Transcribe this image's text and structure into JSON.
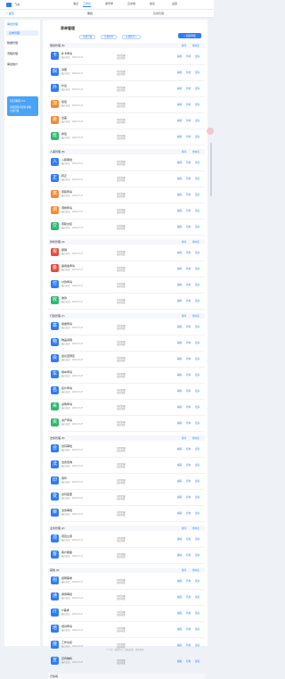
{
  "header": {
    "brand": "飞书",
    "nav": [
      "消息",
      "工作台",
      "通讯录",
      "云文档",
      "会议",
      "设置"
    ],
    "active": 1
  },
  "sub": {
    "back": "< 返回",
    "title": "审批",
    "page": "应用管理"
  },
  "sidebar": {
    "head": "审批管理",
    "items": [
      "表单管理",
      "数据管理",
      "流程管理",
      "审批统计"
    ],
    "active": 0,
    "promo": {
      "title": "钉钉审批 2.0",
      "body": "审批流程可视化 模板全新升级"
    }
  },
  "main": {
    "title": "表单管理",
    "btn_add": "新建分组",
    "btn_sort": "分组排序",
    "btn_import": "从模板导入",
    "btn_primary": "+ 创建审批"
  },
  "actions": {
    "edit": "编辑",
    "stop": "停用",
    "more": "更多",
    "sort": "排序",
    "rename": "重命名"
  },
  "groups": [
    {
      "name": "假勤管理",
      "count": "6",
      "items": [
        {
          "name": "补卡申请",
          "icon": "卡",
          "color": "#2f7cf6",
          "meta": "最近修改：2023-07-27",
          "range": "可见范围",
          "scope": "全员可见"
        },
        {
          "name": "请假",
          "icon": "假",
          "color": "#2f7cf6",
          "meta": "最近修改：2023-07-27",
          "range": "可见范围",
          "scope": "全员可见"
        },
        {
          "name": "外出",
          "icon": "外",
          "color": "#2f7cf6",
          "meta": "最近修改：2023-07-27",
          "range": "可见范围",
          "scope": "全员可见"
        },
        {
          "name": "加班",
          "icon": "加",
          "color": "#f58a32",
          "meta": "最近修改：2023-07-27",
          "range": "可见范围",
          "scope": "全员可见"
        },
        {
          "name": "出差",
          "icon": "差",
          "color": "#f58a32",
          "meta": "最近修改：2023-07-27",
          "range": "可见范围",
          "scope": "全员可见"
        },
        {
          "name": "换班",
          "icon": "班",
          "color": "#2eb872",
          "meta": "最近修改：2023-07-27",
          "range": "可见范围",
          "scope": "全员可见"
        }
      ]
    },
    {
      "name": "人事管理",
      "count": "5",
      "items": [
        {
          "name": "入职审批",
          "icon": "入",
          "color": "#2f7cf6",
          "meta": "最近修改：2023-07-27",
          "range": "可见范围",
          "scope": "全员可见"
        },
        {
          "name": "转正",
          "icon": "正",
          "color": "#2f7cf6",
          "meta": "最近修改：2023-07-27",
          "range": "可见范围",
          "scope": "全员可见"
        },
        {
          "name": "离职申请",
          "icon": "离",
          "color": "#f58a32",
          "meta": "最近修改：2023-07-27",
          "range": "可见范围",
          "scope": "全员可见"
        },
        {
          "name": "调岗申请",
          "icon": "调",
          "color": "#f58a32",
          "meta": "最近修改：2023-07-27",
          "range": "可见范围",
          "scope": "全员可见"
        },
        {
          "name": "离职交接",
          "icon": "交",
          "color": "#2eb872",
          "meta": "最近修改：2023-07-27",
          "range": "可见范围",
          "scope": "全员可见"
        }
      ]
    },
    {
      "name": "财务管理",
      "count": "4",
      "items": [
        {
          "name": "报销",
          "icon": "报",
          "color": "#e74c3c",
          "meta": "最近修改：2023-07-27",
          "range": "可见范围",
          "scope": "全员可见"
        },
        {
          "name": "备用金申请",
          "icon": "备",
          "color": "#e74c3c",
          "meta": "最近修改：2023-07-27",
          "range": "可见范围",
          "scope": "全员可见"
        },
        {
          "name": "付款申请",
          "icon": "付",
          "color": "#2f7cf6",
          "meta": "最近修改：2023-07-27",
          "range": "可见范围",
          "scope": "全员可见"
        },
        {
          "name": "收款",
          "icon": "收",
          "color": "#2eb872",
          "meta": "最近修改：2023-07-27",
          "range": "可见范围",
          "scope": "全员可见"
        }
      ]
    },
    {
      "name": "行政管理",
      "count": "7",
      "items": [
        {
          "name": "用章申请",
          "icon": "章",
          "color": "#2f7cf6",
          "meta": "最近修改：2023-07-27",
          "range": "可见范围",
          "scope": "全员可见"
        },
        {
          "name": "物品领用",
          "icon": "物",
          "color": "#2f7cf6",
          "meta": "最近修改：2023-07-27",
          "range": "可见范围",
          "scope": "全员可见"
        },
        {
          "name": "会议室预定",
          "icon": "会",
          "color": "#2f7cf6",
          "meta": "最近修改：2023-07-27",
          "range": "可见范围",
          "scope": "全员可见"
        },
        {
          "name": "用车申请",
          "icon": "车",
          "color": "#2f7cf6",
          "meta": "最近修改：2023-07-27",
          "range": "可见范围",
          "scope": "全员可见"
        },
        {
          "name": "名片申请",
          "icon": "名",
          "color": "#2f7cf6",
          "meta": "最近修改：2023-07-27",
          "range": "可见范围",
          "scope": "全员可见"
        },
        {
          "name": "采购申请",
          "icon": "采",
          "color": "#2eb872",
          "meta": "最近修改：2023-07-27",
          "range": "可见范围",
          "scope": "全员可见"
        },
        {
          "name": "资产申请",
          "icon": "资",
          "color": "#2eb872",
          "meta": "最近修改：2023-07-27",
          "range": "可见范围",
          "scope": "全员可见"
        }
      ]
    },
    {
      "name": "法务管理",
      "count": "5",
      "items": [
        {
          "name": "合同审批",
          "icon": "合",
          "color": "#2f7cf6",
          "meta": "最近修改：2023-07-27",
          "range": "可见范围",
          "scope": "全员可见"
        },
        {
          "name": "法务咨询",
          "icon": "法",
          "color": "#2f7cf6",
          "meta": "最近修改：2023-07-27",
          "range": "可见范围",
          "scope": "全员可见"
        },
        {
          "name": "用印",
          "icon": "印",
          "color": "#2f7cf6",
          "meta": "最近修改：2023-07-27",
          "range": "可见范围",
          "scope": "全员可见"
        },
        {
          "name": "合同变更",
          "icon": "变",
          "color": "#2f7cf6",
          "meta": "最近修改：2023-07-27",
          "range": "可见范围",
          "scope": "全员可见"
        },
        {
          "name": "法务审批",
          "icon": "审",
          "color": "#2f7cf6",
          "meta": "最近修改：2023-07-27",
          "range": "可见范围",
          "scope": "全员可见"
        }
      ]
    },
    {
      "name": "业务管理",
      "count": "2",
      "items": [
        {
          "name": "项目立项",
          "icon": "项",
          "color": "#2f7cf6",
          "meta": "最近修改：2023-07-27",
          "range": "可见范围",
          "scope": "全员可见"
        },
        {
          "name": "客户报备",
          "icon": "客",
          "color": "#2f7cf6",
          "meta": "最近修改：2023-07-27",
          "range": "可见范围",
          "scope": "全员可见"
        }
      ]
    },
    {
      "name": "其他",
      "count": "6",
      "items": [
        {
          "name": "招聘需求",
          "icon": "招",
          "color": "#2f7cf6",
          "meta": "最近修改：2023-07-27",
          "range": "可见范围",
          "scope": "全员可见"
        },
        {
          "name": "通用审批",
          "icon": "通",
          "color": "#2f7cf6",
          "meta": "最近修改：2023-07-27",
          "range": "可见范围",
          "scope": "全员可见"
        },
        {
          "name": "IT需求",
          "icon": "IT",
          "color": "#2f7cf6",
          "meta": "最近修改：2023-07-27",
          "range": "可见范围",
          "scope": "全员可见"
        },
        {
          "name": "培训申请",
          "icon": "培",
          "color": "#2f7cf6",
          "meta": "最近修改：2023-07-27",
          "range": "可见范围",
          "scope": "全员可见"
        },
        {
          "name": "工作交接",
          "icon": "接",
          "color": "#2f7cf6",
          "meta": "最近修改：2023-07-27",
          "range": "可见范围",
          "scope": "全员可见"
        },
        {
          "name": "宣传物料",
          "icon": "宣",
          "color": "#2f7cf6",
          "meta": "最近修改：2023-07-27",
          "range": "可见范围",
          "scope": "全员可见"
        }
      ]
    },
    {
      "name": "已停用",
      "count": "",
      "items": []
    }
  ],
  "footer": "© 飞书 · 帮助中心 · 隐私政策 · 服务条款"
}
